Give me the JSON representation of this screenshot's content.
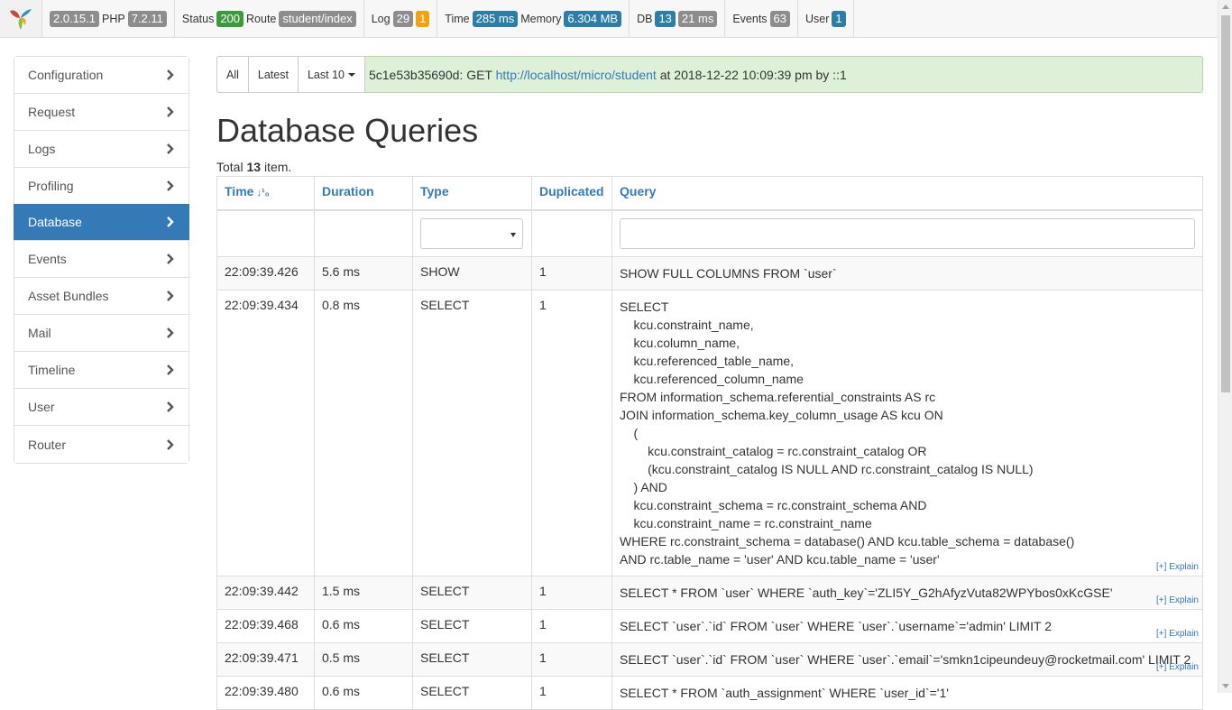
{
  "toolbar": {
    "version": "2.0.15.1",
    "php_label": "PHP",
    "php_version": "7.2.11",
    "status_label": "Status",
    "status_code": "200",
    "route_label": "Route",
    "route": "student/index",
    "log_label": "Log",
    "log_count": "29",
    "log_warnings": "1",
    "time_label": "Time",
    "time_value": "285 ms",
    "memory_label": "Memory",
    "memory_value": "6.304 MB",
    "db_label": "DB",
    "db_count": "13",
    "db_time": "21 ms",
    "events_label": "Events",
    "events_count": "63",
    "user_label": "User",
    "user_count": "1"
  },
  "sidebar": {
    "items": [
      {
        "label": "Configuration"
      },
      {
        "label": "Request"
      },
      {
        "label": "Logs"
      },
      {
        "label": "Profiling"
      },
      {
        "label": "Database"
      },
      {
        "label": "Events"
      },
      {
        "label": "Asset Bundles"
      },
      {
        "label": "Mail"
      },
      {
        "label": "Timeline"
      },
      {
        "label": "User"
      },
      {
        "label": "Router"
      }
    ],
    "active_index": 4
  },
  "summary": {
    "btn_all": "All",
    "btn_latest": "Latest",
    "btn_last10": "Last 10",
    "tag": "5c1e53b35690d: GET",
    "url": "http://localhost/micro/student",
    "suffix": "at 2018-12-22 10:09:39 pm by ::1"
  },
  "page": {
    "title": "Database Queries",
    "total_prefix": "Total",
    "total_count": "13",
    "total_suffix": "item."
  },
  "table": {
    "headers": {
      "time": "Time",
      "duration": "Duration",
      "type": "Type",
      "duplicated": "Duplicated",
      "query": "Query"
    },
    "explain_label": "[+] Explain",
    "rows": [
      {
        "time": "22:09:39.426",
        "duration": "5.6 ms",
        "type": "SHOW",
        "duplicated": "1",
        "query": [
          "SHOW FULL COLUMNS FROM `user`"
        ]
      },
      {
        "time": "22:09:39.434",
        "duration": "0.8 ms",
        "type": "SELECT",
        "duplicated": "1",
        "query": [
          "SELECT",
          "    kcu.constraint_name,",
          "    kcu.column_name,",
          "    kcu.referenced_table_name,",
          "    kcu.referenced_column_name",
          "FROM information_schema.referential_constraints AS rc",
          "JOIN information_schema.key_column_usage AS kcu ON",
          "    (",
          "        kcu.constraint_catalog = rc.constraint_catalog OR",
          "        (kcu.constraint_catalog IS NULL AND rc.constraint_catalog IS NULL)",
          "    ) AND",
          "    kcu.constraint_schema = rc.constraint_schema AND",
          "    kcu.constraint_name = rc.constraint_name",
          "WHERE rc.constraint_schema = database() AND kcu.table_schema = database()",
          "AND rc.table_name = 'user' AND kcu.table_name = 'user'"
        ]
      },
      {
        "time": "22:09:39.442",
        "duration": "1.5 ms",
        "type": "SELECT",
        "duplicated": "1",
        "query": [
          "SELECT * FROM `user` WHERE `auth_key`='ZLI5Y_G2hAfyzVuta82WPYbos0xKcGSE'"
        ]
      },
      {
        "time": "22:09:39.468",
        "duration": "0.6 ms",
        "type": "SELECT",
        "duplicated": "1",
        "query": [
          "SELECT `user`.`id` FROM `user` WHERE `user`.`username`='admin' LIMIT 2"
        ]
      },
      {
        "time": "22:09:39.471",
        "duration": "0.5 ms",
        "type": "SELECT",
        "duplicated": "1",
        "query": [
          "SELECT `user`.`id` FROM `user` WHERE `user`.`email`='smkn1cipeundeuy@rocketmail.com' LIMIT 2"
        ]
      },
      {
        "time": "22:09:39.480",
        "duration": "0.6 ms",
        "type": "SELECT",
        "duplicated": "1",
        "query": [
          "SELECT * FROM `auth_assignment` WHERE `user_id`='1'"
        ]
      }
    ]
  }
}
